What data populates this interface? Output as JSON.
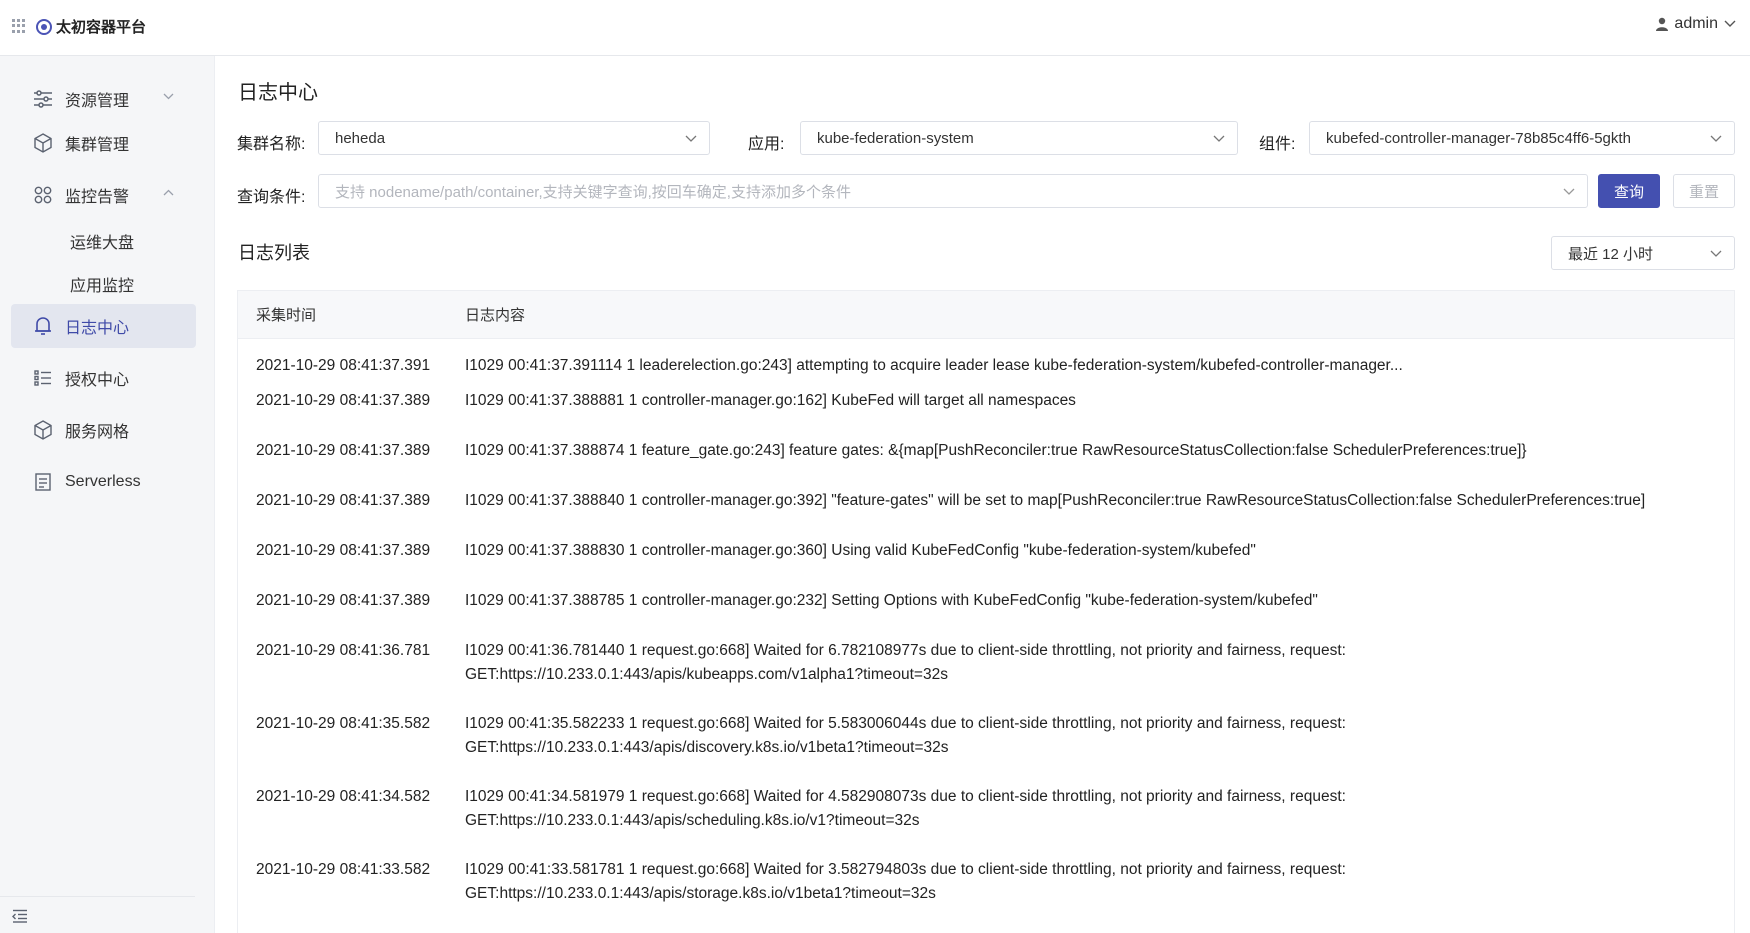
{
  "app": {
    "brand": "太初容器平台",
    "user": "admin"
  },
  "sidebar": {
    "items": [
      {
        "label": "资源管理",
        "icon": "sliders-icon",
        "expand": "down"
      },
      {
        "label": "集群管理",
        "icon": "cube-icon"
      },
      {
        "label": "监控告警",
        "icon": "apps-icon",
        "expand": "up"
      },
      {
        "label": "运维大盘"
      },
      {
        "label": "应用监控"
      },
      {
        "label": "日志中心",
        "icon": "bell-icon",
        "active": true
      },
      {
        "label": "授权中心",
        "icon": "list-icon"
      },
      {
        "label": "服务网格",
        "icon": "cube-icon"
      },
      {
        "label": "Serverless",
        "icon": "document-icon"
      }
    ]
  },
  "page": {
    "title": "日志中心"
  },
  "filters": {
    "cluster_label": "集群名称:",
    "cluster_value": "heheda",
    "app_label": "应用:",
    "app_value": "kube-federation-system",
    "component_label": "组件:",
    "component_value": "kubefed-controller-manager-78b85c4ff6-5gkth",
    "query_label": "查询条件:",
    "query_placeholder": "支持 nodename/path/container,支持关键字查询,按回车确定,支持添加多个条件",
    "search_button": "查询",
    "reset_button": "重置"
  },
  "log_list": {
    "title": "日志列表",
    "time_range": "最近 12 小时",
    "columns": [
      "采集时间",
      "日志内容"
    ],
    "rows": [
      {
        "time": "2021-10-29 08:41:37.391",
        "content": "I1029 00:41:37.391114 1 leaderelection.go:243] attempting to acquire leader lease kube-federation-system/kubefed-controller-manager..."
      },
      {
        "time": "2021-10-29 08:41:37.389",
        "content": "I1029 00:41:37.388881 1 controller-manager.go:162] KubeFed will target all namespaces"
      },
      {
        "time": "2021-10-29 08:41:37.389",
        "content": "I1029 00:41:37.388874 1 feature_gate.go:243] feature gates: &{map[PushReconciler:true RawResourceStatusCollection:false SchedulerPreferences:true]}"
      },
      {
        "time": "2021-10-29 08:41:37.389",
        "content": "I1029 00:41:37.388840 1 controller-manager.go:392] \"feature-gates\" will be set to map[PushReconciler:true RawResourceStatusCollection:false SchedulerPreferences:true]"
      },
      {
        "time": "2021-10-29 08:41:37.389",
        "content": "I1029 00:41:37.388830 1 controller-manager.go:360] Using valid KubeFedConfig \"kube-federation-system/kubefed\""
      },
      {
        "time": "2021-10-29 08:41:37.389",
        "content": "I1029 00:41:37.388785 1 controller-manager.go:232] Setting Options with KubeFedConfig \"kube-federation-system/kubefed\""
      },
      {
        "time": "2021-10-29 08:41:36.781",
        "content": "I1029 00:41:36.781440 1 request.go:668] Waited for 6.782108977s due to client-side throttling, not priority and fairness, request:\nGET:https://10.233.0.1:443/apis/kubeapps.com/v1alpha1?timeout=32s"
      },
      {
        "time": "2021-10-29 08:41:35.582",
        "content": "I1029 00:41:35.582233 1 request.go:668] Waited for 5.583006044s due to client-side throttling, not priority and fairness, request:\nGET:https://10.233.0.1:443/apis/discovery.k8s.io/v1beta1?timeout=32s"
      },
      {
        "time": "2021-10-29 08:41:34.582",
        "content": "I1029 00:41:34.581979 1 request.go:668] Waited for 4.582908073s due to client-side throttling, not priority and fairness, request:\nGET:https://10.233.0.1:443/apis/scheduling.k8s.io/v1?timeout=32s"
      },
      {
        "time": "2021-10-29 08:41:33.582",
        "content": "I1029 00:41:33.581781 1 request.go:668] Waited for 3.582794803s due to client-side throttling, not priority and fairness, request:\nGET:https://10.233.0.1:443/apis/storage.k8s.io/v1beta1?timeout=32s"
      }
    ]
  },
  "colors": {
    "primary": "#4450b0",
    "active_bg": "#e3e6ef",
    "active_text": "#3f4aa8"
  }
}
